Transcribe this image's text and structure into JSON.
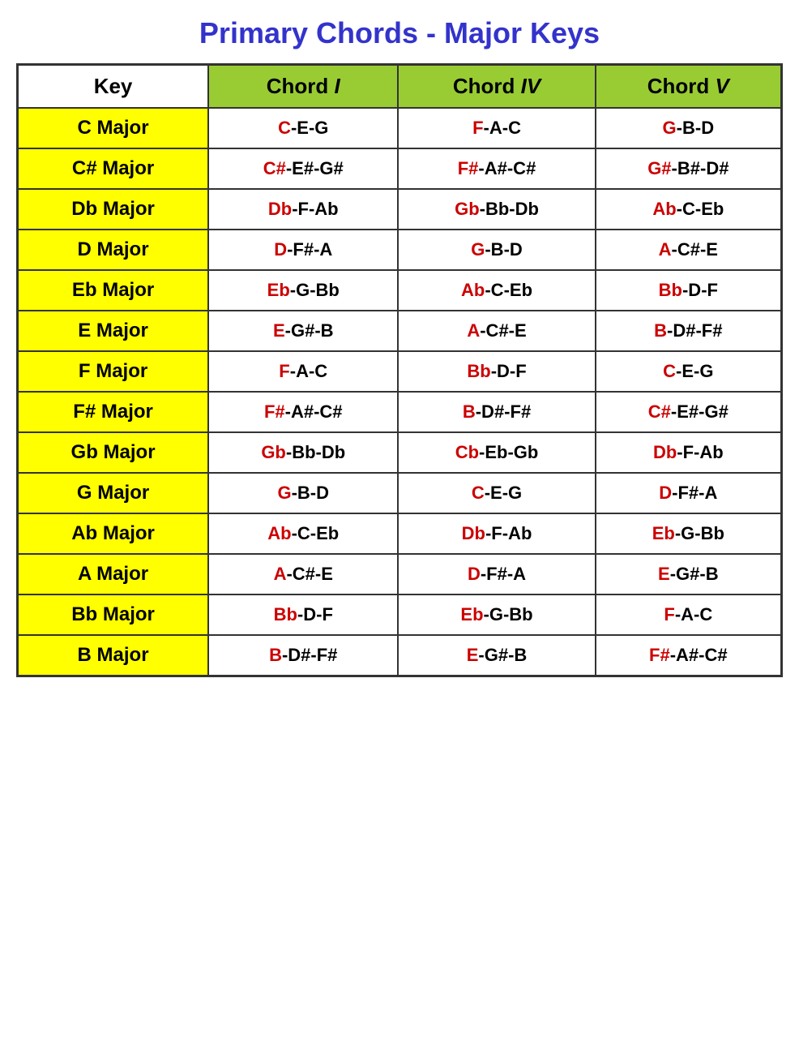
{
  "title": "Primary Chords - Major Keys",
  "headers": {
    "key": "Key",
    "chord1": "Chord",
    "chord1_roman": "I",
    "chord4": "Chord",
    "chord4_roman": "IV",
    "chord5": "Chord",
    "chord5_roman": "V"
  },
  "rows": [
    {
      "key": "C Major",
      "chord1_root": "C",
      "chord1_rest": "-E-G",
      "chord4_root": "F",
      "chord4_rest": "-A-C",
      "chord5_root": "G",
      "chord5_rest": "-B-D"
    },
    {
      "key": "C# Major",
      "chord1_root": "C#",
      "chord1_rest": "-E#-G#",
      "chord4_root": "F#",
      "chord4_rest": "-A#-C#",
      "chord5_root": "G#",
      "chord5_rest": "-B#-D#"
    },
    {
      "key": "Db Major",
      "chord1_root": "Db",
      "chord1_rest": "-F-Ab",
      "chord4_root": "Gb",
      "chord4_rest": "-Bb-Db",
      "chord5_root": "Ab",
      "chord5_rest": "-C-Eb"
    },
    {
      "key": "D Major",
      "chord1_root": "D",
      "chord1_rest": "-F#-A",
      "chord4_root": "G",
      "chord4_rest": "-B-D",
      "chord5_root": "A",
      "chord5_rest": "-C#-E"
    },
    {
      "key": "Eb Major",
      "chord1_root": "Eb",
      "chord1_rest": "-G-Bb",
      "chord4_root": "Ab",
      "chord4_rest": "-C-Eb",
      "chord5_root": "Bb",
      "chord5_rest": "-D-F"
    },
    {
      "key": "E Major",
      "chord1_root": "E",
      "chord1_rest": "-G#-B",
      "chord4_root": "A",
      "chord4_rest": "-C#-E",
      "chord5_root": "B",
      "chord5_rest": "-D#-F#"
    },
    {
      "key": "F Major",
      "chord1_root": "F",
      "chord1_rest": "-A-C",
      "chord4_root": "Bb",
      "chord4_rest": "-D-F",
      "chord5_root": "C",
      "chord5_rest": "-E-G"
    },
    {
      "key": "F# Major",
      "chord1_root": "F#",
      "chord1_rest": "-A#-C#",
      "chord4_root": "B",
      "chord4_rest": "-D#-F#",
      "chord5_root": "C#",
      "chord5_rest": "-E#-G#"
    },
    {
      "key": "Gb Major",
      "chord1_root": "Gb",
      "chord1_rest": "-Bb-Db",
      "chord4_root": "Cb",
      "chord4_rest": "-Eb-Gb",
      "chord5_root": "Db",
      "chord5_rest": "-F-Ab"
    },
    {
      "key": "G Major",
      "chord1_root": "G",
      "chord1_rest": "-B-D",
      "chord4_root": "C",
      "chord4_rest": "-E-G",
      "chord5_root": "D",
      "chord5_rest": "-F#-A"
    },
    {
      "key": "Ab Major",
      "chord1_root": "Ab",
      "chord1_rest": "-C-Eb",
      "chord4_root": "Db",
      "chord4_rest": "-F-Ab",
      "chord5_root": "Eb",
      "chord5_rest": "-G-Bb"
    },
    {
      "key": "A Major",
      "chord1_root": "A",
      "chord1_rest": "-C#-E",
      "chord4_root": "D",
      "chord4_rest": "-F#-A",
      "chord5_root": "E",
      "chord5_rest": "-G#-B"
    },
    {
      "key": "Bb Major",
      "chord1_root": "Bb",
      "chord1_rest": "-D-F",
      "chord4_root": "Eb",
      "chord4_rest": "-G-Bb",
      "chord5_root": "F",
      "chord5_rest": "-A-C"
    },
    {
      "key": "B Major",
      "chord1_root": "B",
      "chord1_rest": "-D#-F#",
      "chord4_root": "E",
      "chord4_rest": "-G#-B",
      "chord5_root": "F#",
      "chord5_rest": "-A#-C#"
    }
  ]
}
